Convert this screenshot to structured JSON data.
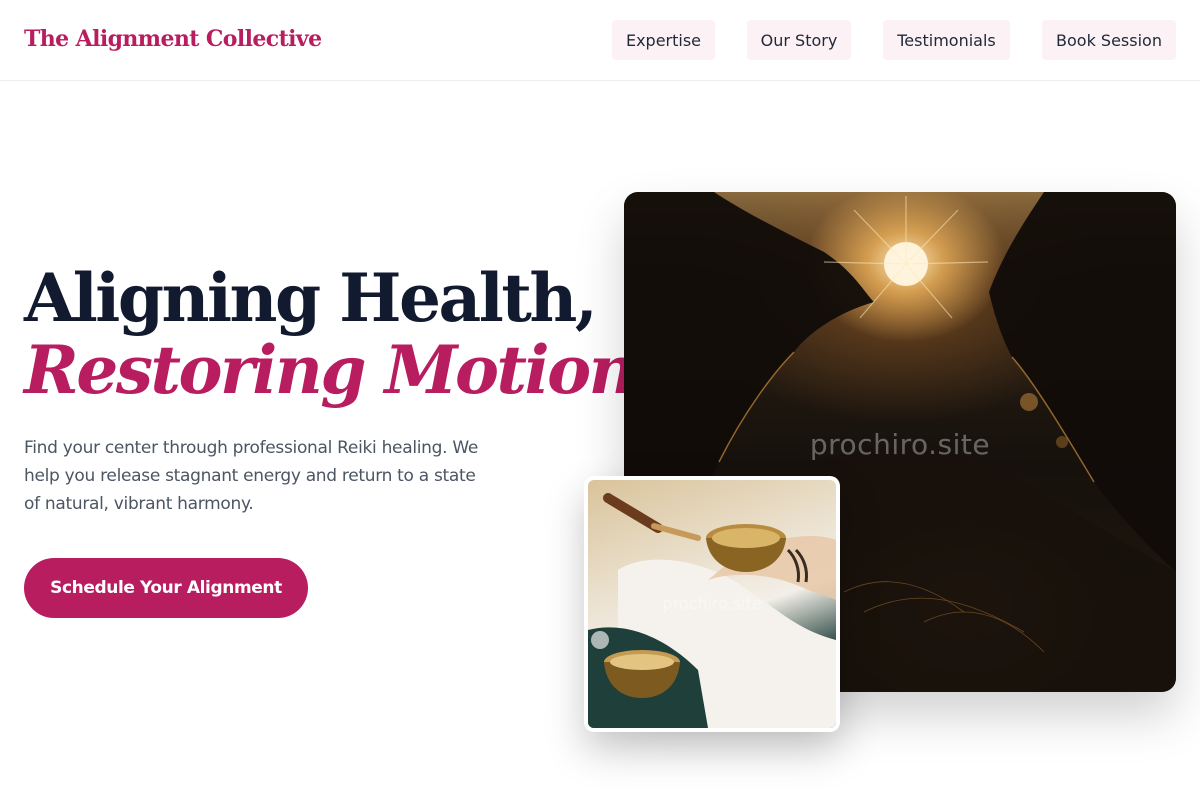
{
  "header": {
    "brand": "The Alignment Collective",
    "nav": [
      "Expertise",
      "Our Story",
      "Testimonials",
      "Book Session"
    ]
  },
  "hero": {
    "headline_line1": "Aligning Health,",
    "headline_line2": "Restoring Motion.",
    "description": "Find your center through professional Reiki healing. We help you release stagnant energy and return to a state of natural, vibrant harmony.",
    "cta_label": "Schedule Your Alignment"
  },
  "images": {
    "main_photo": {
      "icon": "meditation-hands-sunlight-photo",
      "watermark": "prochiro.site"
    },
    "inset_photo": {
      "icon": "singing-bowl-photo",
      "watermark": "prochiro.site"
    }
  },
  "colors": {
    "accent": "#b81d60",
    "heading": "#111a2e",
    "body_text": "#4b5563",
    "nav_button_bg": "#fcf1f4"
  }
}
